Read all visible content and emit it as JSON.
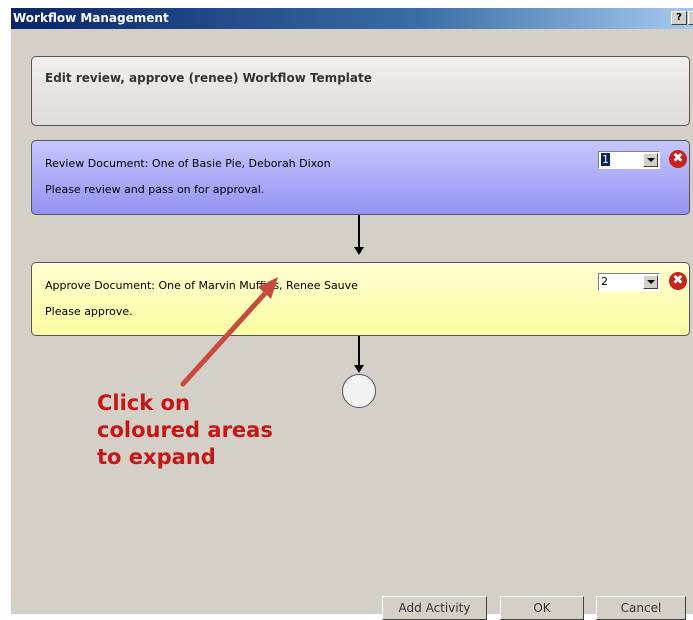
{
  "window": {
    "title": "Workflow Management",
    "help_label": "?",
    "close_label": "✕"
  },
  "template": {
    "header": "Edit review, approve (renee) Workflow Template"
  },
  "activities": [
    {
      "title": "Review Document: One of Basie Pie, Deborah Dixon",
      "description": "Please review and pass on for approval.",
      "order": "1",
      "color": "#b5b5fa"
    },
    {
      "title": "Approve Document: One of Marvin Muffins, Renee Sauve",
      "description": "Please approve.",
      "order": "2",
      "color": "#fdfdbd"
    }
  ],
  "delete_icon": "✖",
  "annotation": {
    "lines": [
      "Click on",
      "coloured areas",
      "to expand"
    ],
    "color": "#c61616"
  },
  "buttons": {
    "add_activity": "Add Activity",
    "ok": "OK",
    "cancel": "Cancel"
  }
}
